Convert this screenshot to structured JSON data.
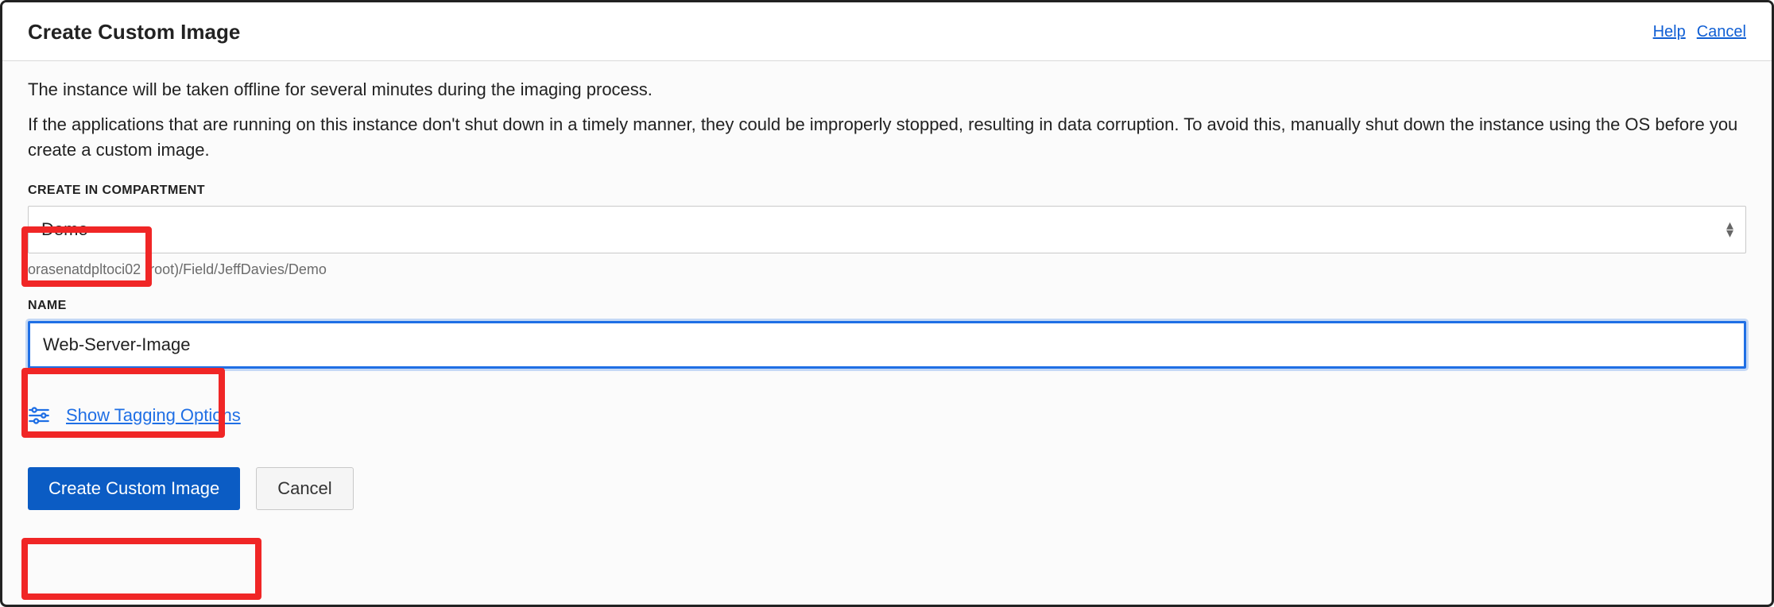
{
  "dialog": {
    "title": "Create Custom Image",
    "help_label": "Help",
    "cancel_link_label": "Cancel"
  },
  "description": {
    "line1": "The instance will be taken offline for several minutes during the imaging process.",
    "line2": "If the applications that are running on this instance don't shut down in a timely manner, they could be improperly stopped, resulting in data corruption. To avoid this, manually shut down the instance using the OS before you create a custom image."
  },
  "compartment": {
    "label": "CREATE IN COMPARTMENT",
    "selected": "Demo",
    "breadcrumb": "orasenatdpltoci02 (root)/Field/JeffDavies/Demo"
  },
  "name": {
    "label": "NAME",
    "value": "Web-Server-Image"
  },
  "tagging": {
    "link_label": "Show Tagging Options"
  },
  "actions": {
    "submit_label": "Create Custom Image",
    "cancel_label": "Cancel"
  }
}
